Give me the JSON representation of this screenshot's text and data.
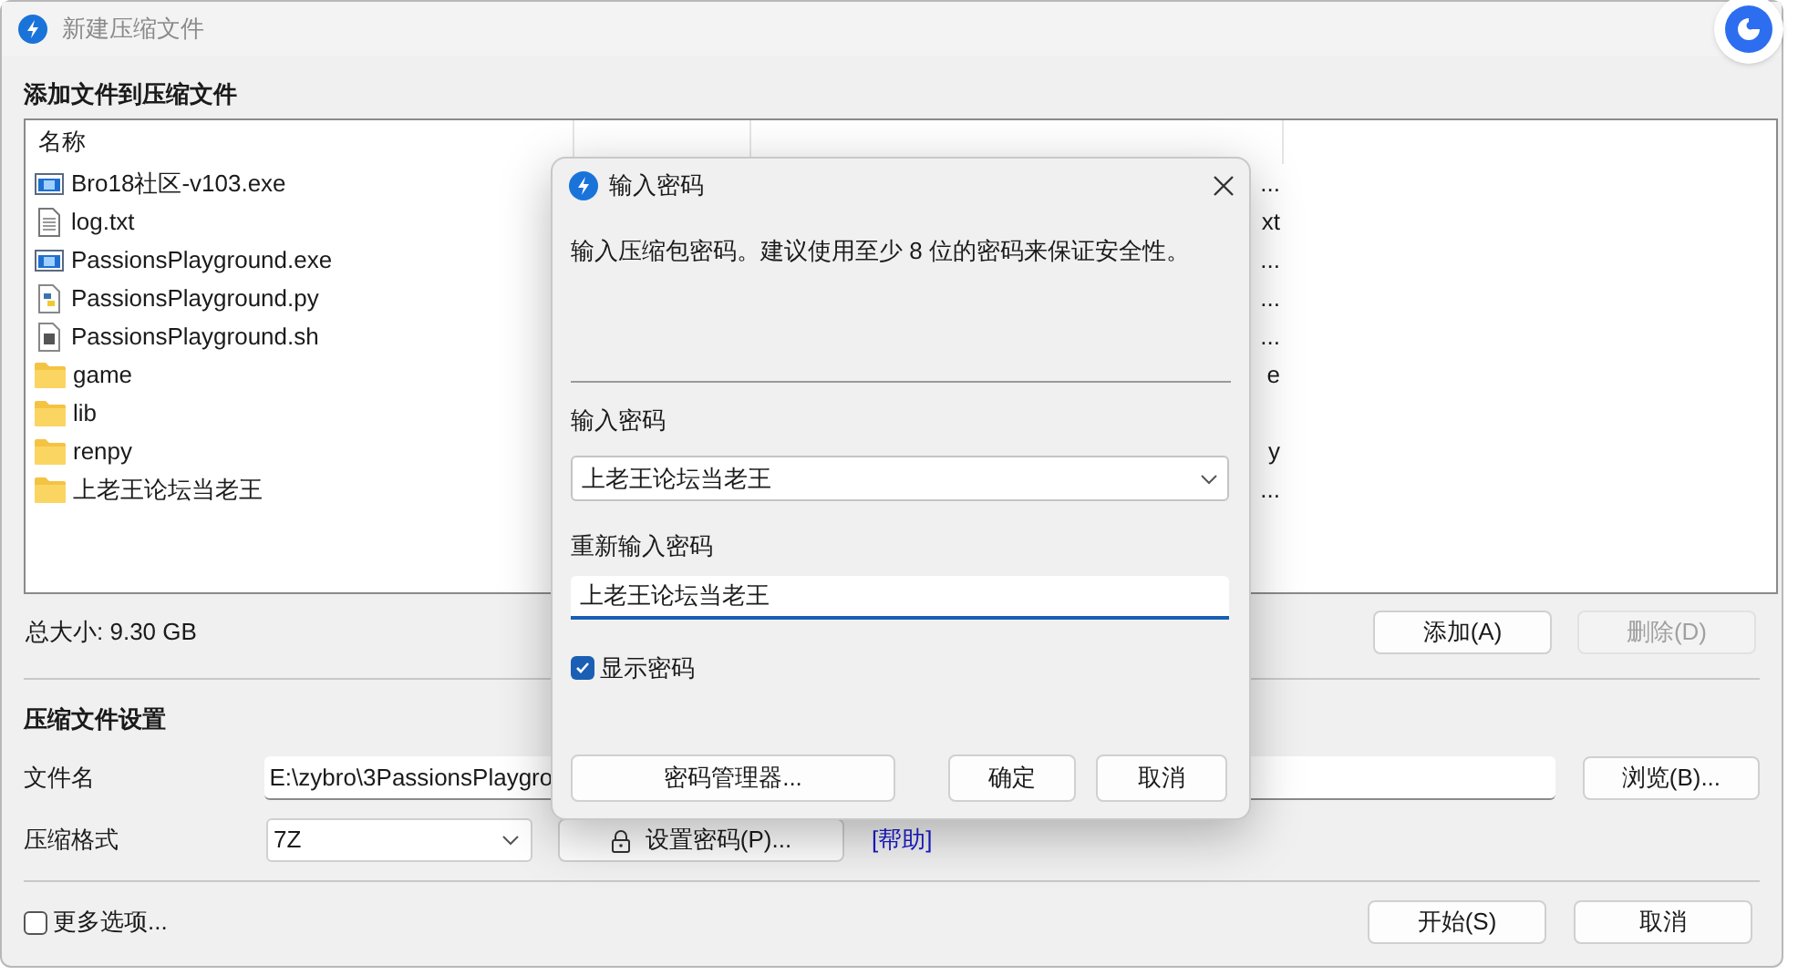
{
  "window": {
    "title": "新建压缩文件"
  },
  "add_section": {
    "heading": "添加文件到压缩文件",
    "column": "名称",
    "files": [
      {
        "kind": "exe",
        "name": "Bro18社区-v103.exe",
        "path": "..."
      },
      {
        "kind": "txt",
        "name": "log.txt",
        "path": "xt"
      },
      {
        "kind": "exe",
        "name": "PassionsPlayground.exe",
        "path": "..."
      },
      {
        "kind": "py",
        "name": "PassionsPlayground.py",
        "path": "..."
      },
      {
        "kind": "sh",
        "name": "PassionsPlayground.sh",
        "path": "..."
      },
      {
        "kind": "folder",
        "name": "game",
        "path": "e"
      },
      {
        "kind": "folder",
        "name": "lib"
      },
      {
        "kind": "folder",
        "name": "renpy",
        "path": "y"
      },
      {
        "kind": "folder",
        "name": "上老王论坛当老王",
        "path": "..."
      }
    ],
    "total_size": "总大小: 9.30 GB",
    "buttons": [
      {
        "label": "添加(A)",
        "disabled": false
      },
      {
        "label": "删除(D)",
        "disabled": true
      }
    ]
  },
  "settings": {
    "heading": "压缩文件设置",
    "filename_label": "文件名",
    "filename": "E:\\zybro\\3PassionsPlaygro",
    "browse": "浏览(B)...",
    "format_label": "压缩格式",
    "format": "7Z",
    "set_password": "设置密码(P)...",
    "help": "[帮助]"
  },
  "more_options": {
    "label": "更多选项...",
    "checked": false
  },
  "footer_buttons": [
    "开始(S)",
    "取消"
  ],
  "dialog": {
    "title": "输入密码",
    "message": "输入压缩包密码。建议使用至少 8 位的密码来保证安全性。",
    "password_label": "输入密码",
    "password": "上老王论坛当老王",
    "confirm_label": "重新输入密码",
    "confirm": "上老王论坛当老王",
    "show_password": {
      "label": "显示密码",
      "checked": true
    },
    "buttons": [
      {
        "label": "密码管理器...",
        "kind": "manager"
      },
      {
        "label": "确定",
        "kind": "default"
      },
      {
        "label": "取消",
        "kind": "normal"
      }
    ]
  }
}
